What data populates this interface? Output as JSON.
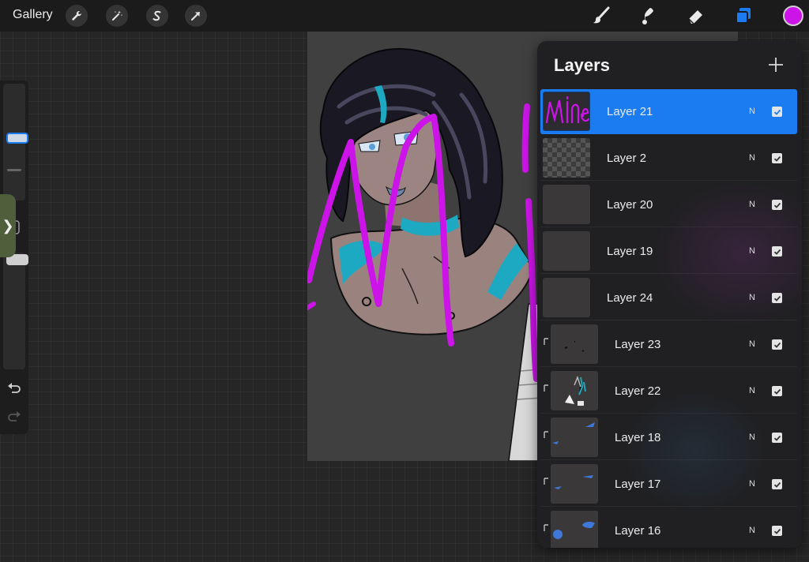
{
  "topbar": {
    "gallery_label": "Gallery",
    "current_color": "#cc14e8",
    "active_tool_color": "#1a7cf0"
  },
  "sidebar": {
    "brush_size_level": 0.55,
    "opacity_level": 1.0,
    "expand_glyph": "❯"
  },
  "layers": {
    "title": "Layers",
    "add_glyph": "+",
    "selected_color": "#1a7cf0",
    "items": [
      {
        "name": "Layer 21",
        "mode": "N",
        "visible": true,
        "selected": true,
        "clipped": false,
        "thumb_text": "Mine"
      },
      {
        "name": "Layer 2",
        "mode": "N",
        "visible": true,
        "selected": false,
        "clipped": false
      },
      {
        "name": "Layer 20",
        "mode": "N",
        "visible": true,
        "selected": false,
        "clipped": false
      },
      {
        "name": "Layer 19",
        "mode": "N",
        "visible": true,
        "selected": false,
        "clipped": false
      },
      {
        "name": "Layer 24",
        "mode": "N",
        "visible": true,
        "selected": false,
        "clipped": false
      },
      {
        "name": "Layer 23",
        "mode": "N",
        "visible": true,
        "selected": false,
        "clipped": true
      },
      {
        "name": "Layer 22",
        "mode": "N",
        "visible": true,
        "selected": false,
        "clipped": true
      },
      {
        "name": "Layer 18",
        "mode": "N",
        "visible": true,
        "selected": false,
        "clipped": true
      },
      {
        "name": "Layer 17",
        "mode": "N",
        "visible": true,
        "selected": false,
        "clipped": true
      },
      {
        "name": "Layer 16",
        "mode": "N",
        "visible": true,
        "selected": false,
        "clipped": true
      }
    ]
  },
  "canvas": {
    "background_color": "#404040",
    "stroke_color": "#cc14e8",
    "accent_color": "#1ea9c2"
  }
}
